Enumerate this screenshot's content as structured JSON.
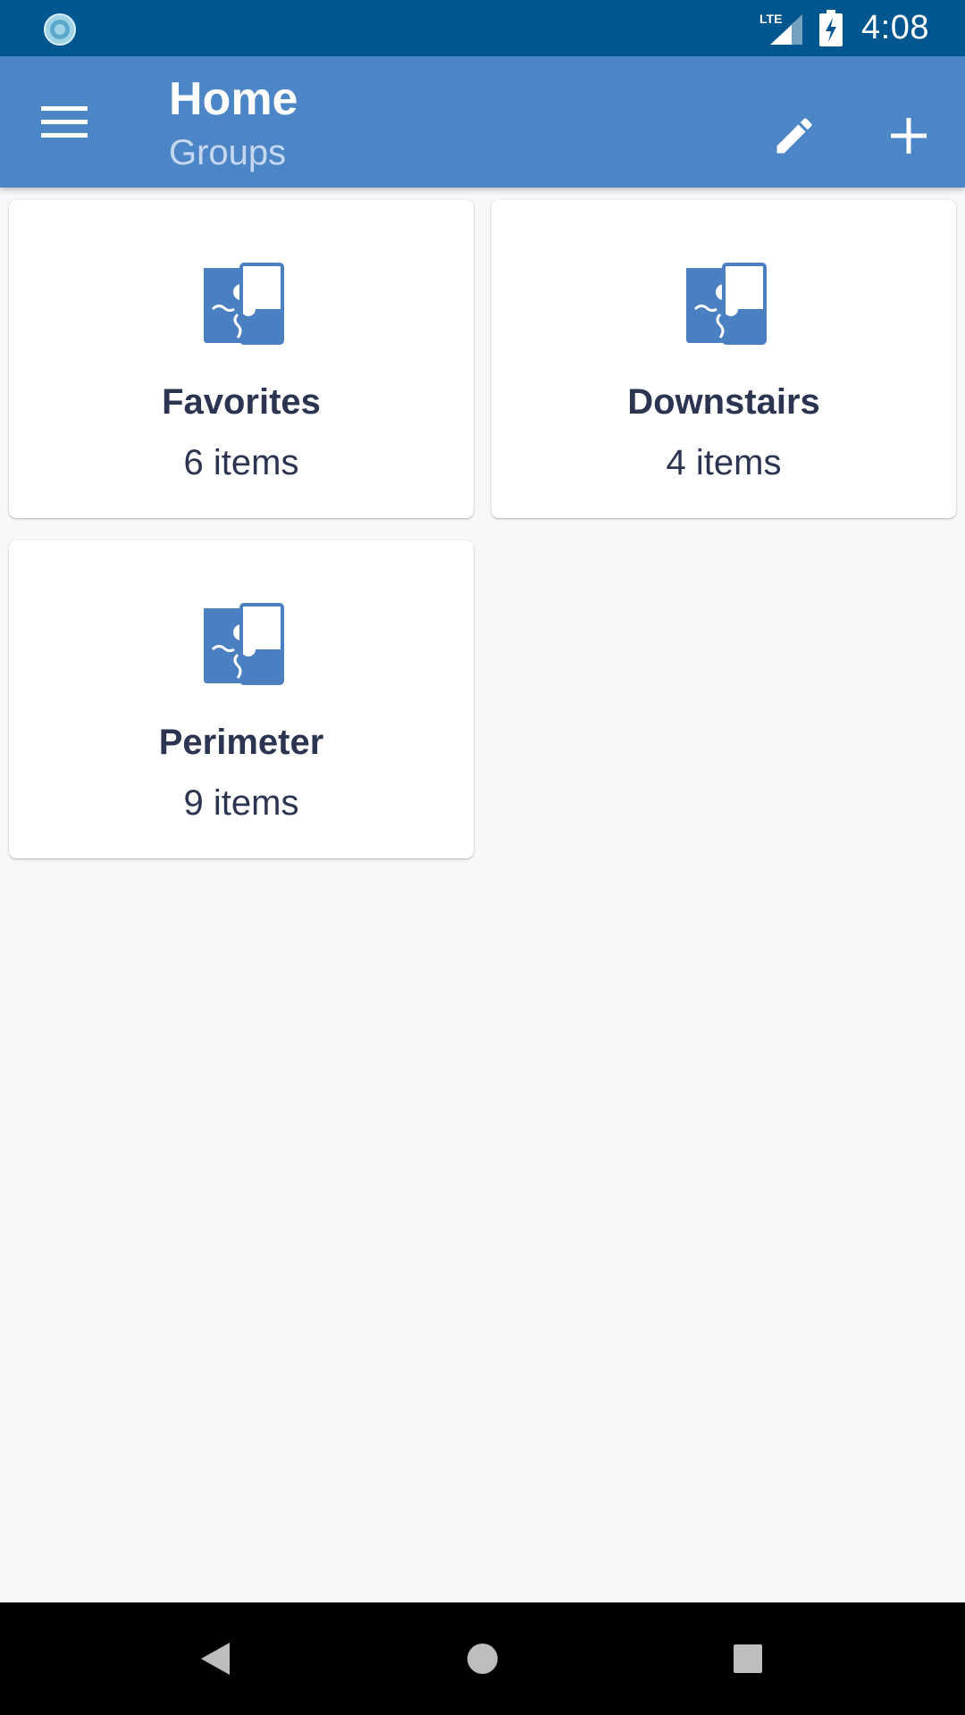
{
  "status_bar": {
    "time": "4:08",
    "network": "LTE",
    "left_icon": "sync-icon",
    "signal_icon": "signal-icon",
    "battery_icon": "battery-charging-icon"
  },
  "app_bar": {
    "title": "Home",
    "subtitle": "Groups",
    "menu_icon": "menu-icon",
    "edit_icon": "pencil-icon",
    "add_icon": "plus-icon"
  },
  "groups": [
    {
      "name": "Favorites",
      "count": "6 items",
      "icon": "puzzle-icon"
    },
    {
      "name": "Downstairs",
      "count": "4 items",
      "icon": "puzzle-icon"
    },
    {
      "name": "Perimeter",
      "count": "9 items",
      "icon": "puzzle-icon"
    }
  ],
  "nav_bar": {
    "back_icon": "back-triangle-icon",
    "home_icon": "home-circle-icon",
    "recents_icon": "recents-square-icon"
  },
  "colors": {
    "status_bar": "#00568f",
    "app_bar": "#4d86c6",
    "accent": "#4a80c2",
    "text_dark": "#2b3450",
    "background": "#f8f7fa"
  }
}
